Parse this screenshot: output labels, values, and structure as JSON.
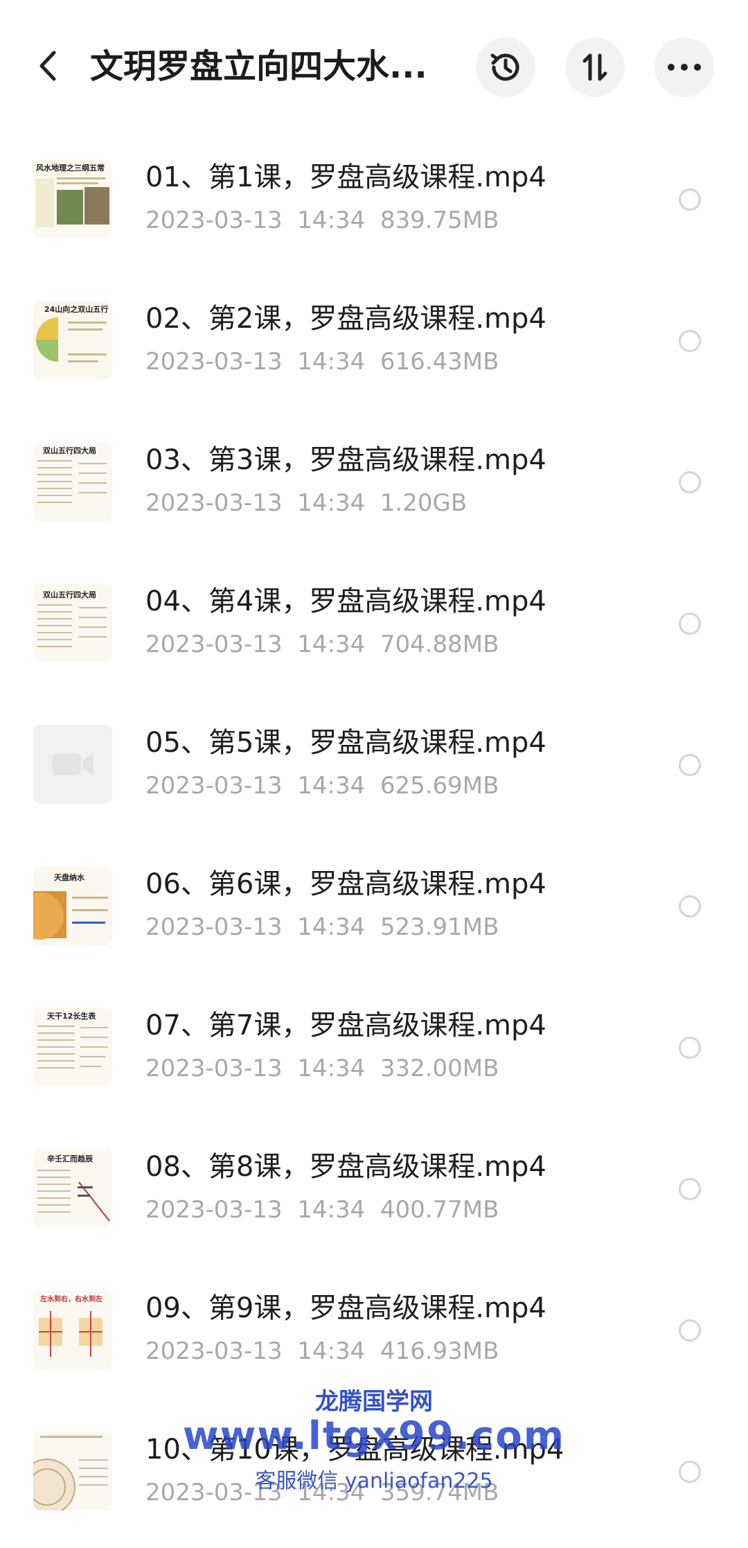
{
  "header": {
    "title": "文玥罗盘立向四大水...",
    "icons": [
      "back-arrow-icon",
      "history-clock-icon",
      "sort-icon",
      "more-icon"
    ]
  },
  "files": [
    {
      "name": "01、第1课，罗盘高级课程.mp4",
      "date": "2023-03-13",
      "time": "14:34",
      "size": "839.75MB",
      "thumb_title": "风水地理之三纲五常"
    },
    {
      "name": "02、第2课，罗盘高级课程.mp4",
      "date": "2023-03-13",
      "time": "14:34",
      "size": "616.43MB",
      "thumb_title": "24山向之双山五行"
    },
    {
      "name": "03、第3课，罗盘高级课程.mp4",
      "date": "2023-03-13",
      "time": "14:34",
      "size": "1.20GB",
      "thumb_title": "双山五行四大局"
    },
    {
      "name": "04、第4课，罗盘高级课程.mp4",
      "date": "2023-03-13",
      "time": "14:34",
      "size": "704.88MB",
      "thumb_title": "双山五行四大局"
    },
    {
      "name": "05、第5课，罗盘高级课程.mp4",
      "date": "2023-03-13",
      "time": "14:34",
      "size": "625.69MB",
      "thumb_title": ""
    },
    {
      "name": "06、第6课，罗盘高级课程.mp4",
      "date": "2023-03-13",
      "time": "14:34",
      "size": "523.91MB",
      "thumb_title": "天盘纳水"
    },
    {
      "name": "07、第7课，罗盘高级课程.mp4",
      "date": "2023-03-13",
      "time": "14:34",
      "size": "332.00MB",
      "thumb_title": "天干12长生表"
    },
    {
      "name": "08、第8课，罗盘高级课程.mp4",
      "date": "2023-03-13",
      "time": "14:34",
      "size": "400.77MB",
      "thumb_title": "辛壬汇而趋辰"
    },
    {
      "name": "09、第9课，罗盘高级课程.mp4",
      "date": "2023-03-13",
      "time": "14:34",
      "size": "416.93MB",
      "thumb_title": "左水到右，右水到左"
    },
    {
      "name": "10、第10课，罗盘高级课程.mp4",
      "date": "2023-03-13",
      "time": "14:34",
      "size": "359.74MB",
      "thumb_title": ""
    }
  ],
  "watermark": {
    "line1": "龙腾国学网",
    "line2": "www.ltgx99.com",
    "line3": "客服微信 yanliaofan225"
  },
  "colors": {
    "text": "#1e1e1e",
    "meta": "#a8a8a8",
    "button_bg": "#f2f2f2",
    "watermark": "#3451c7"
  }
}
